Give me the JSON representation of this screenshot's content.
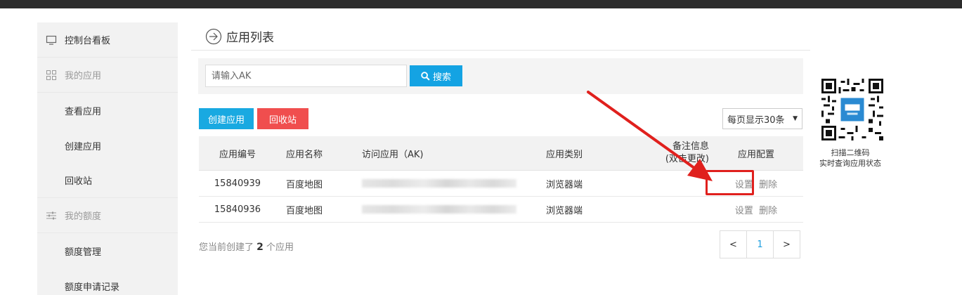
{
  "sidebar": {
    "items": [
      {
        "label": "控制台看板",
        "type": "top",
        "icon": "monitor-icon"
      },
      {
        "label": "我的应用",
        "type": "group",
        "icon": "grid-icon"
      },
      {
        "label": "查看应用",
        "type": "sub"
      },
      {
        "label": "创建应用",
        "type": "sub"
      },
      {
        "label": "回收站",
        "type": "sub"
      },
      {
        "label": "我的额度",
        "type": "group",
        "icon": "sliders-icon"
      },
      {
        "label": "额度管理",
        "type": "sub"
      },
      {
        "label": "额度申请记录",
        "type": "sub"
      }
    ]
  },
  "header": {
    "title": "应用列表"
  },
  "search": {
    "placeholder": "请输入AK",
    "button_label": "搜索"
  },
  "toolbar": {
    "create_label": "创建应用",
    "recycle_label": "回收站",
    "per_page_label": "每页显示30条"
  },
  "table": {
    "headers": [
      "应用编号",
      "应用名称",
      "访问应用（AK)",
      "应用类别",
      "备注信息\n(双击更改)",
      "应用配置"
    ],
    "header_remark_line1": "备注信息",
    "header_remark_line2": "(双击更改)",
    "rows": [
      {
        "id": "15840939",
        "name": "百度地图",
        "category": "浏览器端",
        "remark": "",
        "setting": "设置",
        "delete": "删除"
      },
      {
        "id": "15840936",
        "name": "百度地图",
        "category": "浏览器端",
        "remark": "",
        "setting": "设置",
        "delete": "删除"
      }
    ]
  },
  "footer": {
    "prefix": "您当前创建了",
    "count": "2",
    "suffix": "个应用"
  },
  "pagination": {
    "prev": "<",
    "current": "1",
    "next": ">"
  },
  "qr": {
    "line1": "扫描二维码",
    "line2": "实时查询应用状态"
  },
  "colors": {
    "primary": "#19a9e1",
    "danger": "#f04e4e",
    "annotation": "#e0201d"
  }
}
